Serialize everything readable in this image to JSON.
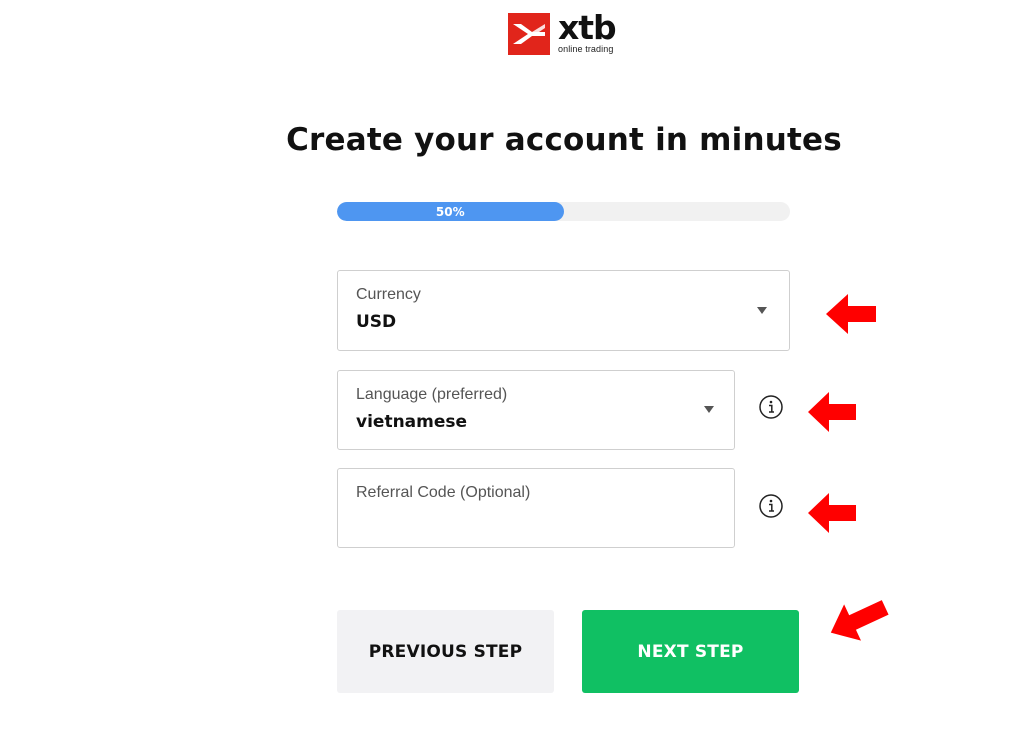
{
  "brand": {
    "name": "xtb",
    "tagline": "online trading",
    "accent_color": "#e1251b"
  },
  "title": "Create your account in minutes",
  "progress": {
    "label": "50%",
    "value": 0.5,
    "color": "#4e96f1"
  },
  "form": {
    "currency": {
      "label": "Currency",
      "value": "USD"
    },
    "language": {
      "label": "Language (preferred)",
      "value": "vietnamese"
    },
    "referral": {
      "label": "Referral Code (Optional)",
      "value": ""
    }
  },
  "buttons": {
    "previous": "PREVIOUS STEP",
    "next": "NEXT STEP",
    "next_color": "#10c063"
  },
  "icons": {
    "info": "info-icon",
    "dropdown": "chevron-down-icon",
    "annotation": "red-arrow-icon"
  }
}
